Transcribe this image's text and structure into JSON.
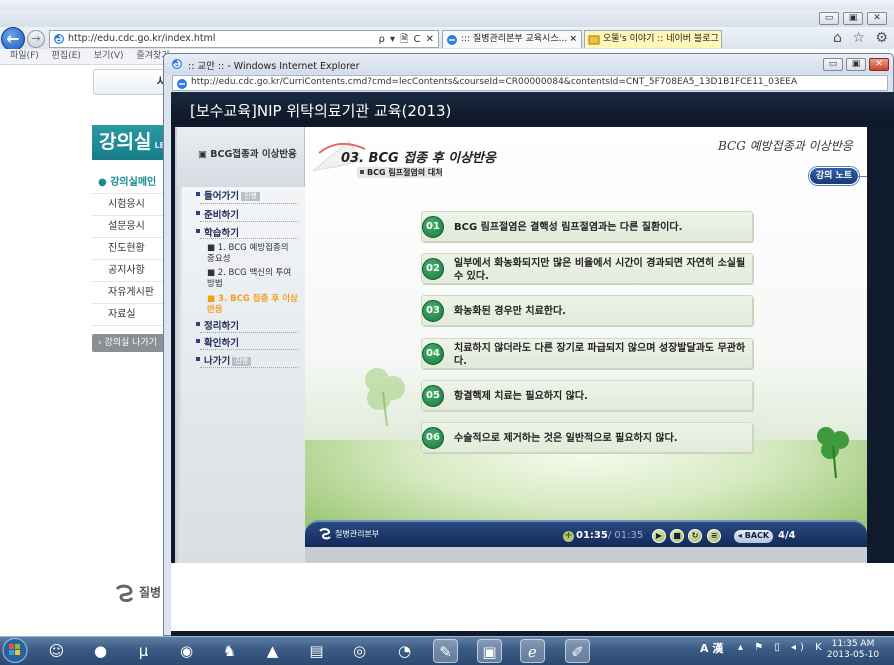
{
  "background_window": {
    "address_url": "http://edu.cdc.go.kr/index.html",
    "address_tools": "ρ ▾ 🗎 C ✕",
    "tabs": [
      {
        "label": "::: 질병관리본부 교육시스..."
      },
      {
        "label": "오뚤's 이야기 :: 네이버 블로그"
      }
    ],
    "menubar": [
      "파일(F)",
      "편집(E)",
      "보기(V)",
      "즐겨찾기"
    ],
    "window_controls": [
      "▭",
      "▣",
      "✕"
    ],
    "right_icons": "⌂ ☆ ⚙",
    "page": {
      "banner_text": "사",
      "lecture_room_title": "강의실",
      "lecture_room_suffix": "LE",
      "side_menu": [
        "강의실메인",
        "시험응시",
        "설문응시",
        "진도현황",
        "공지사항",
        "자유게시판",
        "자료실"
      ],
      "side_button": "강의실 나가기",
      "footer_logo": "질병"
    }
  },
  "popup_window": {
    "title": ":: 교안 :: - Windows Internet Explorer",
    "address_url": "http://edu.cdc.go.kr/CurriContents.cmd?cmd=lecContents&courseId=CR00000084&contentsId=CNT_5F708EA5_13D1B1FCE11_03EEA",
    "window_controls": [
      "▭",
      "▣",
      "✕"
    ]
  },
  "course": {
    "title": "[보수교육]NIP 위탁의료기관 교육(2013)",
    "left_nav": {
      "tab_label": "BCG접종과 이상반응",
      "items": [
        {
          "label": "들어가기",
          "badge": "진행"
        },
        {
          "label": "준비하기",
          "badge": ""
        },
        {
          "label": "학습하기",
          "badge": ""
        }
      ],
      "sub_items": [
        "1. BCG 예방접종의 중요성",
        "2. BCG 백신의 투여방법",
        "3. BCG 접종 후 이상반응"
      ],
      "items_after": [
        {
          "label": "정리하기",
          "badge": ""
        },
        {
          "label": "확인하기",
          "badge": ""
        },
        {
          "label": "나가기",
          "badge": "진행"
        }
      ]
    },
    "section_title": "03. BCG 접종 후 이상반응",
    "section_subtitle": "BCG 림프절염의 대처",
    "topic_title": "BCG 예방접종과 이상반응",
    "lecture_note_button": "강의 노트",
    "points": [
      {
        "num": "01",
        "text": "BCG 림프절염은 결핵성 림프절염과는 다른 질환이다."
      },
      {
        "num": "02",
        "text": "일부에서 화농화되지만 많은 비율에서 시간이 경과되면 자연히 소실될 수 있다."
      },
      {
        "num": "03",
        "text": "화농화된 경우만 치료한다."
      },
      {
        "num": "04",
        "text": "치료하지 않더라도 다른 장기로 파급되지 않으며 성장발달과도 무관하다."
      },
      {
        "num": "05",
        "text": "항결핵제 치료는 필요하지 않다."
      },
      {
        "num": "06",
        "text": "수술적으로 제거하는 것은 일반적으로 필요하지 않다."
      }
    ],
    "control_bar": {
      "logo_text": "질병관리본부",
      "current_time": "01:35",
      "total_time": "/ 01:35",
      "back_label": "BACK",
      "page_indicator": "4/4",
      "buttons": [
        "▶",
        "■",
        "↻",
        "≡"
      ]
    }
  },
  "taskbar": {
    "ime_text": "A 漢",
    "tray_icons": "▴ ⚑ ▯ ◂) K",
    "time": "11:35 AM",
    "date": "2013-05-10"
  }
}
